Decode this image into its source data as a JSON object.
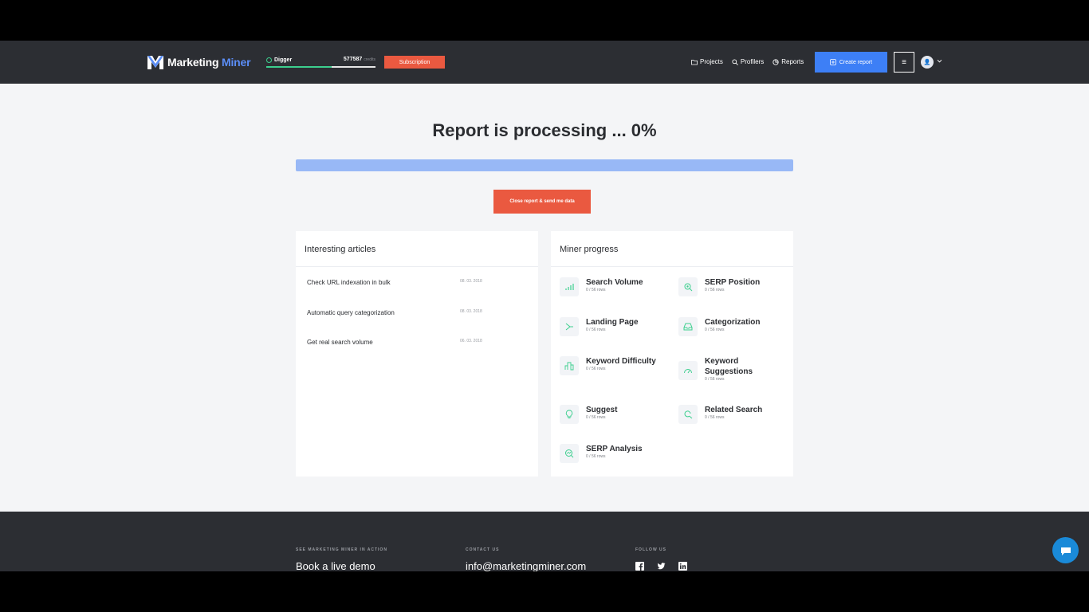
{
  "header": {
    "logo_main": "Marketing",
    "logo_accent": "Miner",
    "plan_name": "Digger",
    "credits_value": "577587",
    "credits_unit": "credits",
    "credits_fraction": 0.6,
    "subscription_label": "Subscription",
    "nav": [
      {
        "label": "Projects",
        "icon": "folder-icon"
      },
      {
        "label": "Profilers",
        "icon": "search-icon"
      },
      {
        "label": "Reports",
        "icon": "pie-chart-icon"
      }
    ],
    "create_label": "Create report",
    "menu_glyph": "≡",
    "avatar_glyph": "👤"
  },
  "main": {
    "title": "Report is processing ... 0%",
    "progress_percent": 0,
    "close_label": "Close report & send me data"
  },
  "articles": {
    "heading": "Interesting articles",
    "items": [
      {
        "title": "Check URL indexation in bulk",
        "date": "08. 03. 2018"
      },
      {
        "title": "Automatic query categorization",
        "date": "08. 03. 2018"
      },
      {
        "title": "Get real search volume",
        "date": "06. 03. 2018"
      }
    ]
  },
  "miners": {
    "heading": "Miner progress",
    "items": [
      {
        "name": "Search Volume",
        "rows": "0 / 56 rows",
        "icon": "bar-chart-icon"
      },
      {
        "name": "SERP Position",
        "rows": "0 / 56 rows",
        "icon": "magnifier-icon"
      },
      {
        "name": "Landing Page",
        "rows": "0 / 56 rows",
        "icon": "share-icon"
      },
      {
        "name": "Categorization",
        "rows": "0 / 56 rows",
        "icon": "inbox-icon"
      },
      {
        "name": "Keyword Difficulty",
        "rows": "0 / 56 rows",
        "icon": "difficulty-bars-icon"
      },
      {
        "name": "Keyword Suggestions",
        "rows": "0 / 56 rows",
        "icon": "gauge-icon"
      },
      {
        "name": "Suggest",
        "rows": "0 / 56 rows",
        "icon": "lightbulb-icon"
      },
      {
        "name": "Related Search",
        "rows": "0 / 56 rows",
        "icon": "refresh-search-icon"
      },
      {
        "name": "SERP Analysis",
        "rows": "0 / 56 rows",
        "icon": "analysis-icon"
      }
    ]
  },
  "footer": {
    "demo_label": "SEE MARKETING MINER IN ACTION",
    "demo_value": "Book a live demo",
    "contact_label": "CONTACT US",
    "contact_value": "info@marketingminer.com",
    "follow_label": "FOLLOW US",
    "socials": [
      "facebook-icon",
      "twitter-icon",
      "linkedin-icon"
    ]
  },
  "colors": {
    "header_bg": "#2c2e33",
    "accent_blue": "#3d7ff6",
    "accent_red": "#ea5940",
    "accent_green": "#3ccf8e"
  }
}
